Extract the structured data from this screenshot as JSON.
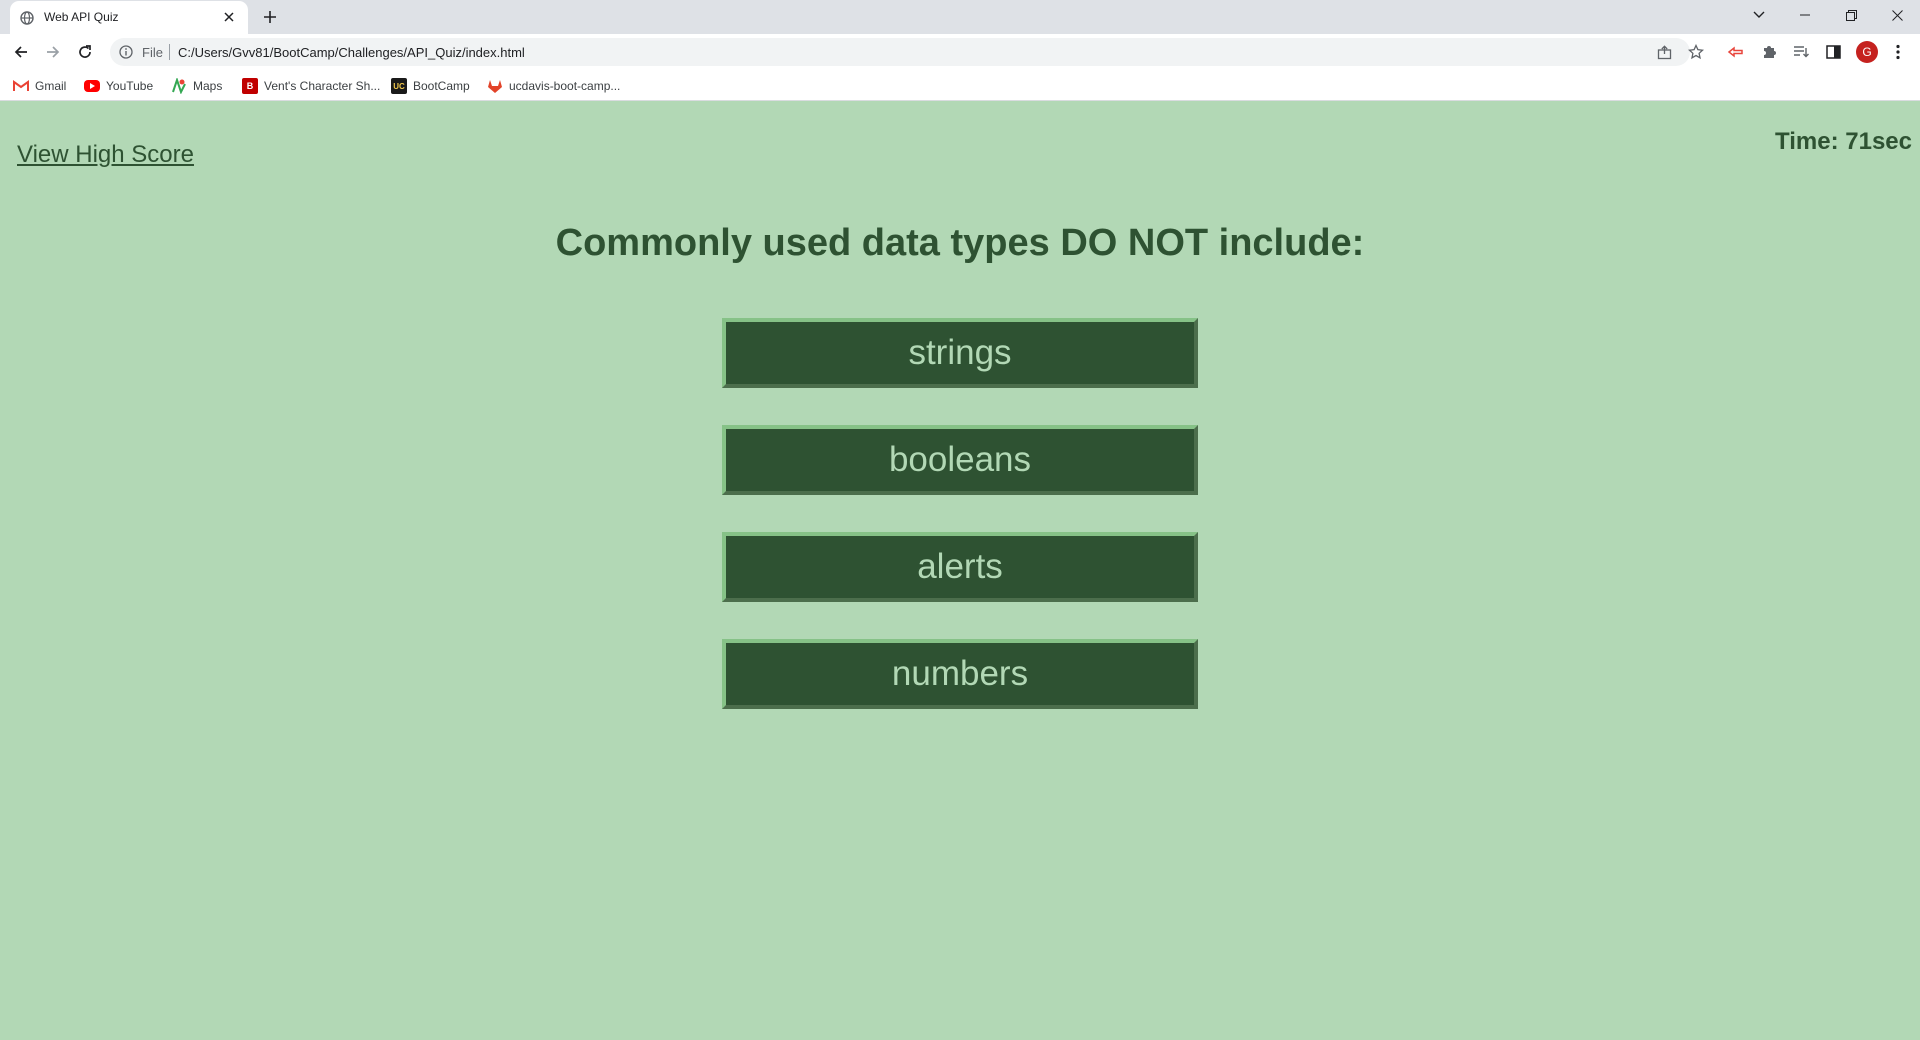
{
  "browser": {
    "tab_title": "Web API Quiz",
    "scheme_label": "File",
    "url": "C:/Users/Gvv81/BootCamp/Challenges/API_Quiz/index.html",
    "profile_initial": "G",
    "bookmarks": [
      {
        "label": "Gmail",
        "icon": "gmail-icon",
        "color": "#ea4335"
      },
      {
        "label": "YouTube",
        "icon": "youtube-icon",
        "color": "#ff0000"
      },
      {
        "label": "Maps",
        "icon": "maps-icon",
        "color": "#34a853"
      },
      {
        "label": "Vent's Character Sh...",
        "icon": "b-logo-icon",
        "color": "#c00000"
      },
      {
        "label": "BootCamp",
        "icon": "uc-logo-icon",
        "color": "#1a1a1a"
      },
      {
        "label": "ucdavis-boot-camp...",
        "icon": "gitlab-icon",
        "color": "#e24329"
      }
    ]
  },
  "page": {
    "high_score_link": "View High Score",
    "timer": "Time: 71sec",
    "question": "Commonly used data types DO NOT include:",
    "answers": [
      "strings",
      "booleans",
      "alerts",
      "numbers"
    ]
  },
  "colors": {
    "background": "#b2d8b5",
    "primary": "#2e5232",
    "button_border": "#86c287"
  }
}
